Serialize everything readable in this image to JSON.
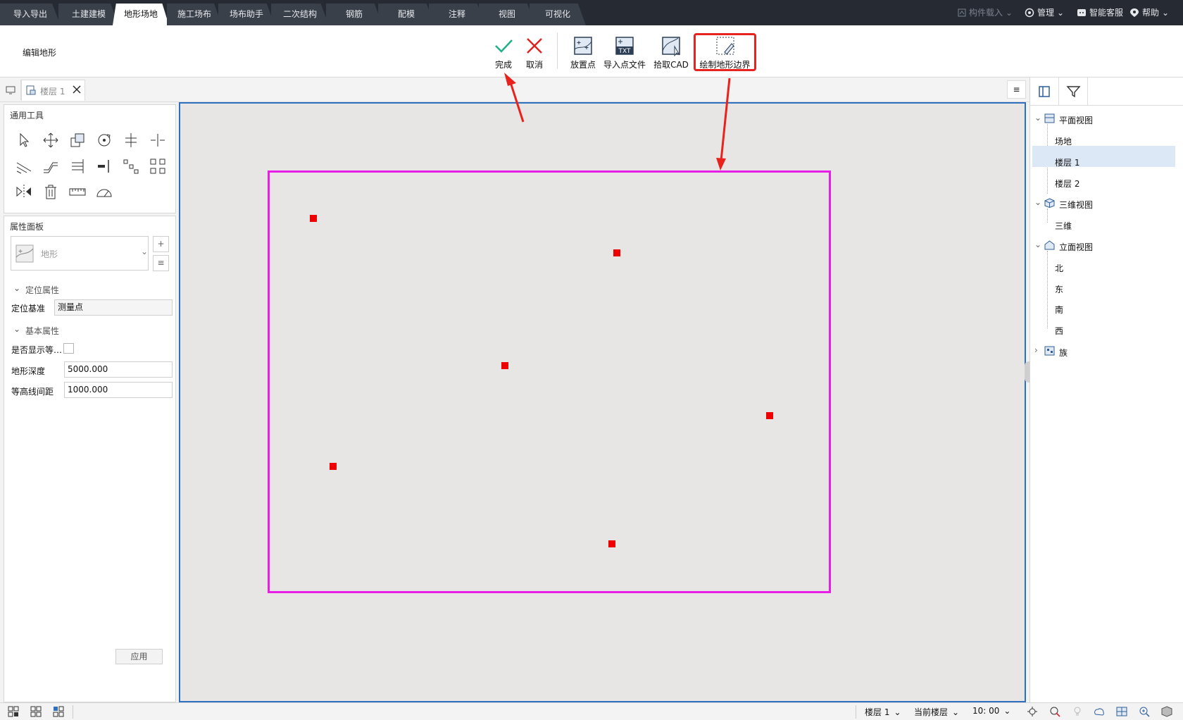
{
  "top_tabs": [
    "导入导出",
    "土建建模",
    "地形场地",
    "施工场布",
    "场布助手",
    "二次结构",
    "钢筋",
    "配模",
    "注释",
    "视图",
    "可视化"
  ],
  "top_right": {
    "component_load": "构件载入",
    "manage": "管理",
    "service": "智能客服",
    "help": "帮助"
  },
  "ribbon": {
    "mode_title": "编辑地形",
    "finish": "完成",
    "cancel": "取消",
    "place_point": "放置点",
    "import_points": "导入点文件",
    "pick_cad": "拾取CAD",
    "draw_boundary": "绘制地形边界",
    "txt_icon_text": "TXT"
  },
  "doc_tab": {
    "label": "楼层 1"
  },
  "tools": {
    "title": "通用工具"
  },
  "props": {
    "title": "属性面板",
    "type_name": "地形",
    "section_position": "定位属性",
    "position_base_label": "定位基准",
    "position_base_value": "测量点",
    "section_basic": "基本属性",
    "show_contour_label": "是否显示等…",
    "show_contour_checked": false,
    "depth_label": "地形深度",
    "depth_value": "5000.000",
    "contour_interval_label": "等高线间距",
    "contour_interval_value": "1000.000",
    "apply": "应用"
  },
  "tree": {
    "plan": "平面视图",
    "site": "场地",
    "floor1": "楼层 1",
    "floor2": "楼层 2",
    "threed": "三维视图",
    "threed_item": "三维",
    "elevation": "立面视图",
    "north": "北",
    "east": "东",
    "south": "南",
    "west": "西",
    "family": "族"
  },
  "status": {
    "floor": "楼层 1",
    "scope": "当前楼层",
    "scale": "10: 00"
  },
  "colors": {
    "boundary": "#e61ee6",
    "point": "#e60000",
    "annotation": "#e8221c",
    "selection": "#2f6fbf"
  }
}
